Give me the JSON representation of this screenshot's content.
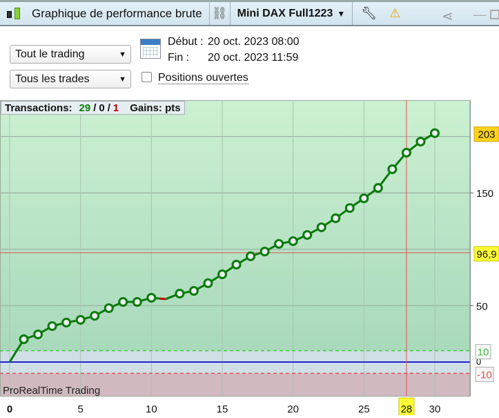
{
  "header": {
    "title": "Graphique de performance brute",
    "instrument": "Mini DAX Full1223",
    "icons": [
      "candlestick-icon",
      "link-icon",
      "wrench-icon",
      "warning-icon",
      "share-icon",
      "minimize-icon",
      "maximize-icon"
    ]
  },
  "filters": {
    "period": "Tout le trading",
    "trades": "Tous les trades",
    "open_positions_label": "Positions ouvertes",
    "open_positions_checked": false
  },
  "dates": {
    "start_label": "Début :",
    "start": "20 oct. 2023 08:00",
    "end_label": "Fin :",
    "end": "20 oct. 2023 11:59"
  },
  "summary": {
    "label": "Transactions:",
    "wins": "29",
    "sep": "/",
    "neutral": "0",
    "losses": "1",
    "gains_label": "Gains: pts"
  },
  "watermark": "ProRealTime Trading",
  "colors": {
    "line": "#0a7a0a",
    "loss": "#c00000",
    "zero": "#2020d0",
    "green_band": "#c9efd1",
    "neutral_band": "#d0dfe6",
    "red_band": "#d1b9c0"
  },
  "chart_data": {
    "type": "line",
    "x": [
      0,
      1,
      2,
      3,
      4,
      5,
      6,
      7,
      8,
      9,
      10,
      11,
      12,
      13,
      14,
      15,
      16,
      17,
      18,
      19,
      20,
      21,
      22,
      23,
      24,
      25,
      26,
      27,
      28,
      29,
      30
    ],
    "values": [
      0,
      20.2,
      24.5,
      31.9,
      35,
      37.4,
      41,
      47.8,
      53.3,
      53.3,
      57,
      55.8,
      60.7,
      63.1,
      69.9,
      77.8,
      86.4,
      93.8,
      98,
      104.8,
      107.2,
      112.7,
      119.5,
      127.5,
      136.6,
      145.2,
      154.4,
      171,
      185.7,
      195.5,
      203
    ],
    "xlim": [
      0,
      32.5
    ],
    "ylim": [
      -22,
      232
    ],
    "x_ticks": [
      "0",
      "5",
      "10",
      "15",
      "20",
      "25",
      "30"
    ],
    "y_ticks": [
      "50",
      "150"
    ],
    "y_grid": [
      50,
      100,
      150,
      200
    ],
    "last_value_label": "203",
    "cursor": {
      "x": 28,
      "y": 96.9,
      "x_label": "28",
      "y_label": "96,9"
    },
    "thresholds": {
      "upper": 10,
      "lower": -10,
      "upper_label": "10",
      "lower_label": "-10",
      "zero_label": "0"
    }
  }
}
